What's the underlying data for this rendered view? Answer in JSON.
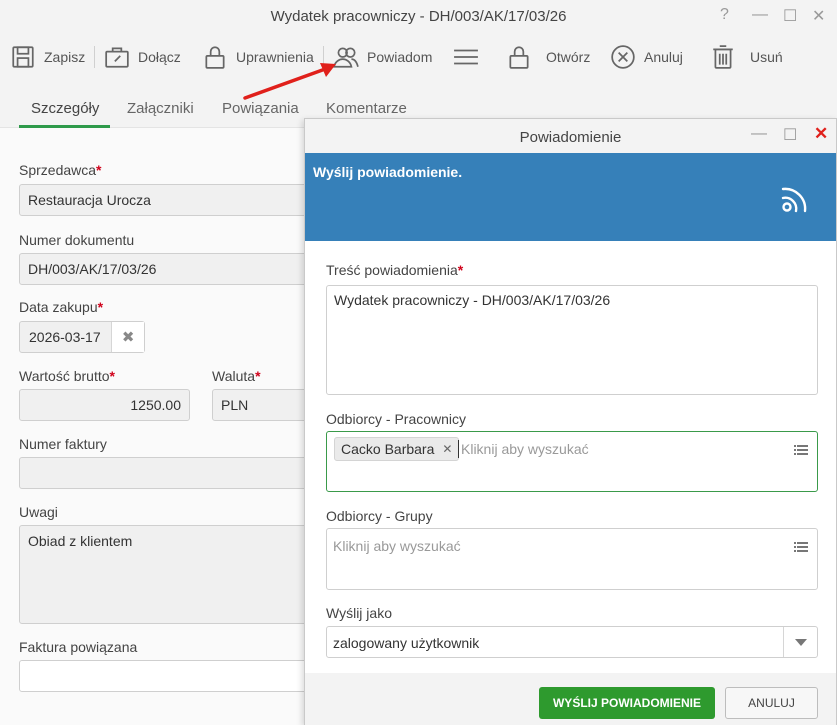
{
  "window": {
    "title": "Wydatek pracowniczy - DH/003/AK/17/03/26"
  },
  "toolbar": {
    "save": "Zapisz",
    "attach": "Dołącz",
    "permissions": "Uprawnienia",
    "notify": "Powiadom",
    "open": "Otwórz",
    "cancel": "Anuluj",
    "delete": "Usuń"
  },
  "tabs": [
    "Szczegóły",
    "Załączniki",
    "Powiązania",
    "Komentarze"
  ],
  "form": {
    "seller_label": "Sprzedawca",
    "seller_value": "Restauracja Urocza",
    "doc_number_label": "Numer dokumentu",
    "doc_number_value": "DH/003/AK/17/03/26",
    "purchase_date_label": "Data zakupu",
    "purchase_date_value": "2026-03-17",
    "gross_label": "Wartość brutto",
    "gross_value": "1250.00",
    "currency_label": "Waluta",
    "currency_value": "PLN",
    "invoice_label": "Numer faktury",
    "invoice_value": "",
    "notes_label": "Uwagi",
    "notes_value": "Obiad z klientem",
    "related_invoice_label": "Faktura powiązana",
    "related_invoice_value": ""
  },
  "dialog": {
    "title": "Powiadomienie",
    "banner": "Wyślij powiadomienie.",
    "content_label": "Treść powiadomienia",
    "content_value": "Wydatek pracowniczy - DH/003/AK/17/03/26",
    "employees_label": "Odbiorcy - Pracownicy",
    "employee_tag": "Cacko Barbara",
    "employees_placeholder": "Kliknij aby wyszukać",
    "groups_label": "Odbiorcy - Grupy",
    "groups_placeholder": "Kliknij aby wyszukać",
    "send_as_label": "Wyślij jako",
    "send_as_value": "zalogowany użytkownik",
    "send_button": "WYŚLIJ POWIADOMIENIE",
    "cancel_button": "ANULUJ"
  },
  "colors": {
    "accent": "#2e9a4a",
    "banner": "#3680b9",
    "required": "#d0021b",
    "arrow": "#e0201b"
  },
  "required_mark": "*"
}
